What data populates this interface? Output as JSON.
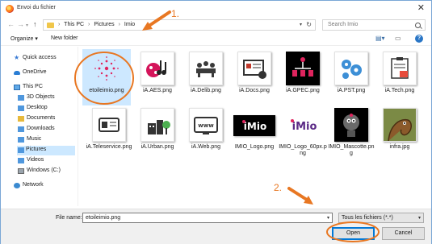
{
  "window": {
    "title": "Envoi du fichier",
    "close_glyph": "✕"
  },
  "nav": {
    "breadcrumb": [
      "This PC",
      "Pictures",
      "Imio"
    ],
    "search_placeholder": "Search Imio"
  },
  "toolbar": {
    "organize_label": "Organize ▾",
    "new_folder_label": "New folder"
  },
  "sidebar": {
    "items": [
      {
        "label": "Quick access",
        "icon": "star-icon"
      },
      {
        "label": "OneDrive",
        "icon": "cloud-icon"
      },
      {
        "label": "This PC",
        "icon": "computer-icon"
      },
      {
        "label": "3D Objects",
        "icon": "folder-icon"
      },
      {
        "label": "Desktop",
        "icon": "folder-icon"
      },
      {
        "label": "Documents",
        "icon": "folder-icon"
      },
      {
        "label": "Downloads",
        "icon": "download-folder-icon"
      },
      {
        "label": "Music",
        "icon": "music-folder-icon"
      },
      {
        "label": "Pictures",
        "icon": "pictures-folder-icon",
        "selected": true
      },
      {
        "label": "Videos",
        "icon": "videos-folder-icon"
      },
      {
        "label": "Windows (C:)",
        "icon": "drive-icon"
      },
      {
        "label": "Network",
        "icon": "network-icon"
      }
    ]
  },
  "files": [
    {
      "name": "etoileimio.png",
      "selected": true,
      "thumb": "star-logo"
    },
    {
      "name": "iA.AES.png",
      "thumb": "aes"
    },
    {
      "name": "iA.Delib.png",
      "thumb": "delib"
    },
    {
      "name": "iA.Docs.png",
      "thumb": "docs"
    },
    {
      "name": "iA.GPEC.png",
      "thumb": "gpec"
    },
    {
      "name": "iA.PST.png",
      "thumb": "pst"
    },
    {
      "name": "iA.Tech.png",
      "thumb": "tech"
    },
    {
      "name": "iA.Teleservice.png",
      "thumb": "teleservice"
    },
    {
      "name": "iA.Urban.png",
      "thumb": "urban"
    },
    {
      "name": "iA.Web.png",
      "thumb": "web"
    },
    {
      "name": "IMIO_Logo.png",
      "thumb": "imio-logo"
    },
    {
      "name": "IMIO_Logo_60px.png",
      "thumb": "imio-logo-60"
    },
    {
      "name": "IMIO_Mascotte.png",
      "thumb": "mascotte"
    },
    {
      "name": "infra.jpg",
      "thumb": "infra"
    }
  ],
  "footer": {
    "file_name_label": "File name:",
    "file_name_value": "etoileimio.png",
    "file_type_value": "Tous les fichiers (*.*)",
    "open_label": "Open",
    "cancel_label": "Cancel"
  },
  "annotations": {
    "step1": "1.",
    "step2": "2.",
    "color": "#e87722"
  }
}
